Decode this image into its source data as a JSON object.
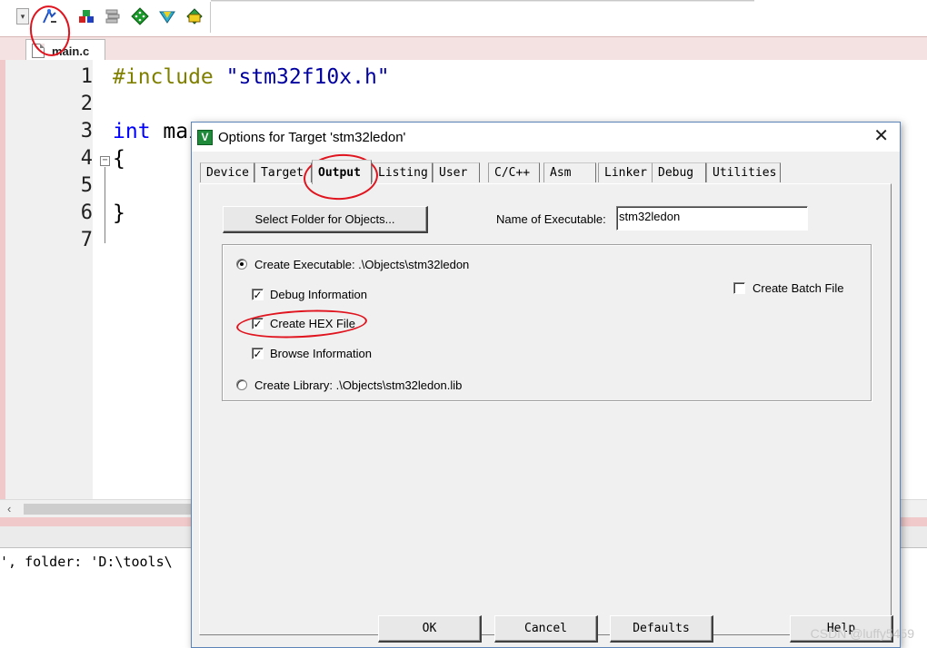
{
  "toolbar": {
    "icons": [
      "manage-project-icon",
      "component-icon",
      "books-icon",
      "diamond-icon",
      "pack-installer-icon",
      "run-icon"
    ]
  },
  "editor": {
    "tab_label": "main.c",
    "line_numbers": [
      "1",
      "2",
      "3",
      "4",
      "5",
      "6",
      "7"
    ],
    "lines": {
      "l1_directive": "#include",
      "l1_string": " \"stm32f10x.h\"",
      "l3_keyword": "int",
      "l3_rest": " mai",
      "l4": "{",
      "l6": "}"
    }
  },
  "output": {
    "text": "', folder: 'D:\\tools\\"
  },
  "dialog": {
    "title": "Options for Target 'stm32ledon'",
    "close_symbol": "✕",
    "tabs": [
      "Device",
      "Target",
      "Output",
      "Listing",
      "User",
      "C/C++",
      "Asm",
      "Linker",
      "Debug",
      "Utilities"
    ],
    "active_tab": "Output",
    "select_folder_label": "Select Folder for Objects...",
    "name_of_executable_label": "Name of Executable:",
    "name_of_executable_value": "stm32ledon",
    "create_executable_label": "Create Executable:  .\\Objects\\stm32ledon",
    "debug_info_label": "Debug Information",
    "create_hex_label": "Create HEX File",
    "browse_info_label": "Browse Information",
    "create_library_label": "Create Library:  .\\Objects\\stm32ledon.lib",
    "create_batch_label": "Create Batch File",
    "options": {
      "create_executable": true,
      "create_library": false,
      "debug_information": true,
      "create_hex_file": true,
      "browse_information": true,
      "create_batch_file": false
    },
    "ok_label": "OK",
    "cancel_label": "Cancel",
    "defaults_label": "Defaults",
    "help_label": "Help"
  },
  "watermark": "CSDN @luffy5459",
  "colors": {
    "annotation": "#e0141e",
    "preprocessor": "#7f7f00",
    "string": "#0000a0",
    "keyword": "#0000ff",
    "tab_strip": "#f4e2e2"
  }
}
